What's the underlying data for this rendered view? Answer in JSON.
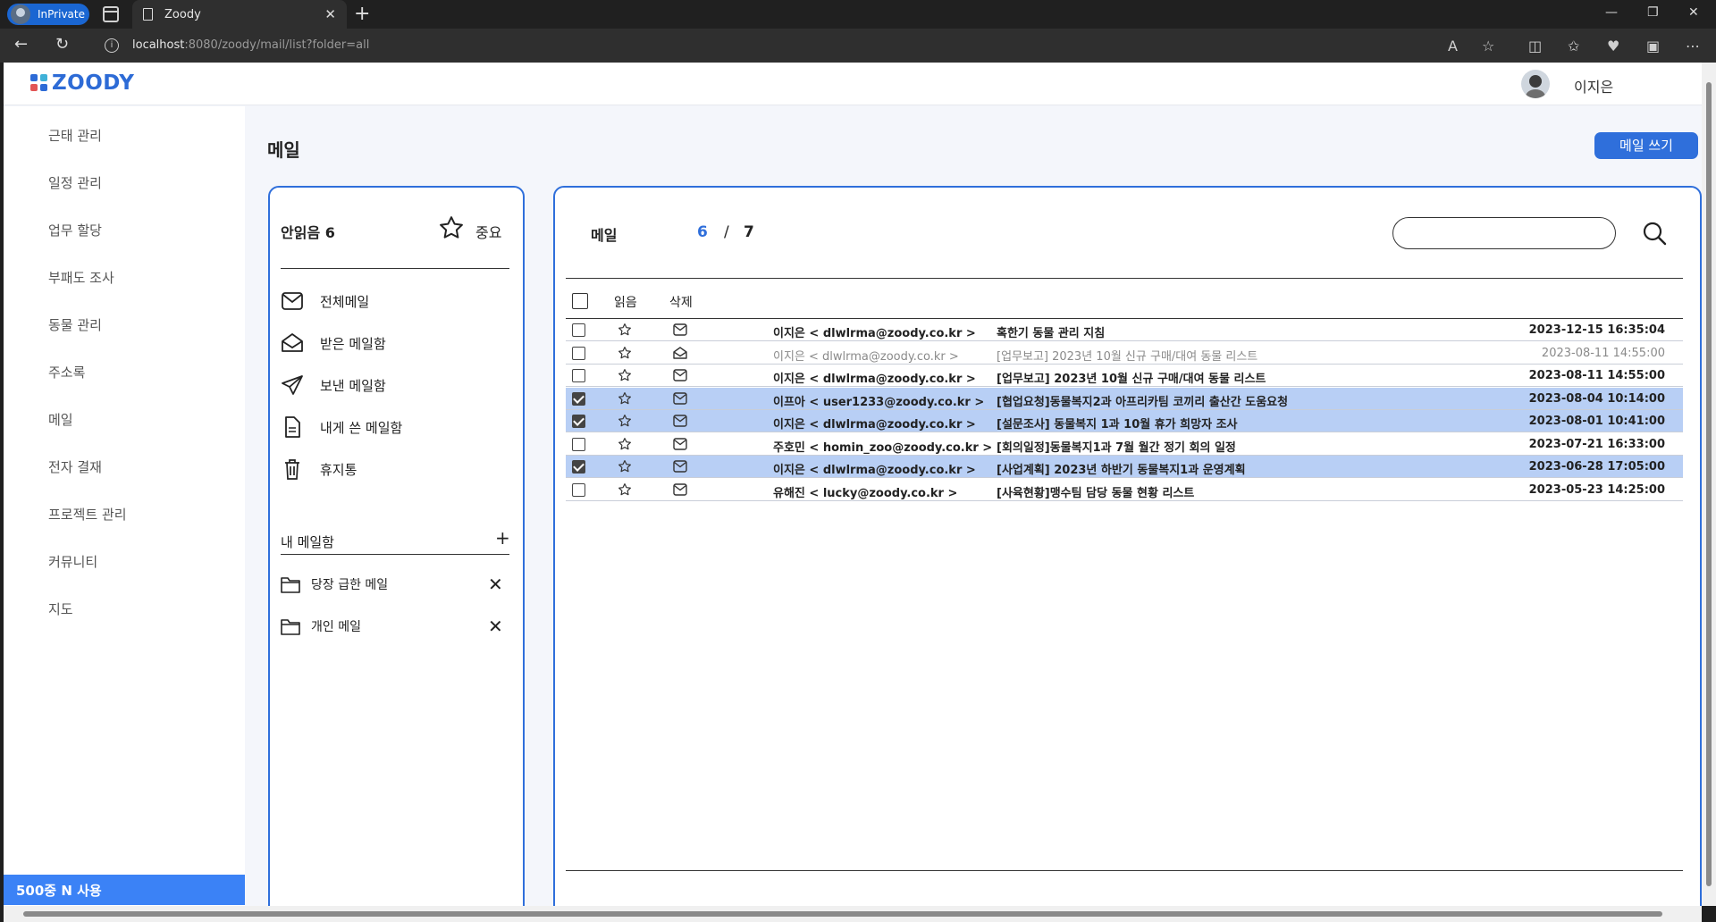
{
  "browser": {
    "inprivate_label": "InPrivate",
    "tab_title": "Zoody",
    "url_host": "localhost",
    "url_rest": ":8080/zoody/mail/list?folder=all"
  },
  "header": {
    "logo_text": "ZOODY",
    "username": "이지은"
  },
  "sidebar": {
    "items": [
      "근태 관리",
      "일정 관리",
      "업무 할당",
      "부패도 조사",
      "동물 관리",
      "주소록",
      "메일",
      "전자 결재",
      "프로젝트 관리",
      "커뮤니티",
      "지도"
    ],
    "storage": "500중 N 사용"
  },
  "page": {
    "title": "메일",
    "compose_label": "메일 쓰기"
  },
  "folders": {
    "unread_label": "안읽음 6",
    "important_label": "중요",
    "items": [
      "전체메일",
      "받은 메일함",
      "보낸 메일함",
      "내게 쓴 메일함",
      "휴지통"
    ],
    "my_mailbox_label": "내 메일함",
    "my_mailboxes": [
      "당장 급한 메일",
      "개인 메일"
    ]
  },
  "maillist": {
    "label": "메일",
    "unread_count": "6",
    "slash": "/",
    "total_count": "7",
    "search_placeholder": "",
    "col_read": "읽음",
    "col_delete": "삭제",
    "rows": [
      {
        "from": "이지은 < dlwlrma@zoody.co.kr >",
        "subject": "혹한기 동물 관리 지침",
        "date": "2023-12-15 16:35:04",
        "checked": false,
        "read": false
      },
      {
        "from": "이지은 < dlwlrma@zoody.co.kr >",
        "subject": "[업무보고] 2023년 10월 신규 구매/대여 동물 리스트",
        "date": "2023-08-11 14:55:00",
        "checked": false,
        "read": true
      },
      {
        "from": "이지은 < dlwlrma@zoody.co.kr >",
        "subject": "[업무보고] 2023년 10월 신규 구매/대여 동물 리스트",
        "date": "2023-08-11 14:55:00",
        "checked": false,
        "read": false
      },
      {
        "from": "이프아 < user1233@zoody.co.kr >",
        "subject": "[협업요청]동물복지2과 아프리카팀 코끼리 출산간 도움요청",
        "date": "2023-08-04 10:14:00",
        "checked": true,
        "read": false
      },
      {
        "from": "이지은 < dlwlrma@zoody.co.kr >",
        "subject": "[설문조사] 동물복지 1과 10월 휴가 희망자 조사",
        "date": "2023-08-01 10:41:00",
        "checked": true,
        "read": false
      },
      {
        "from": "주호민 < homin_zoo@zoody.co.kr >",
        "subject": "[회의일정]동물복지1과 7월 월간 정기 회의 일정",
        "date": "2023-07-21 16:33:00",
        "checked": false,
        "read": false
      },
      {
        "from": "이지은 < dlwlrma@zoody.co.kr >",
        "subject": "[사업계획] 2023년 하반기 동물복지1과 운영계획",
        "date": "2023-06-28 17:05:00",
        "checked": true,
        "read": false
      },
      {
        "from": "유해진 < lucky@zoody.co.kr >",
        "subject": "[사육현황]맹수팀 담당 동물 현황 리스트",
        "date": "2023-05-23 14:25:00",
        "checked": false,
        "read": false
      }
    ]
  },
  "colors": {
    "accent": "#2f6fdb",
    "selected_row": "#b8cff5",
    "storage_bar": "#3b82f6"
  }
}
